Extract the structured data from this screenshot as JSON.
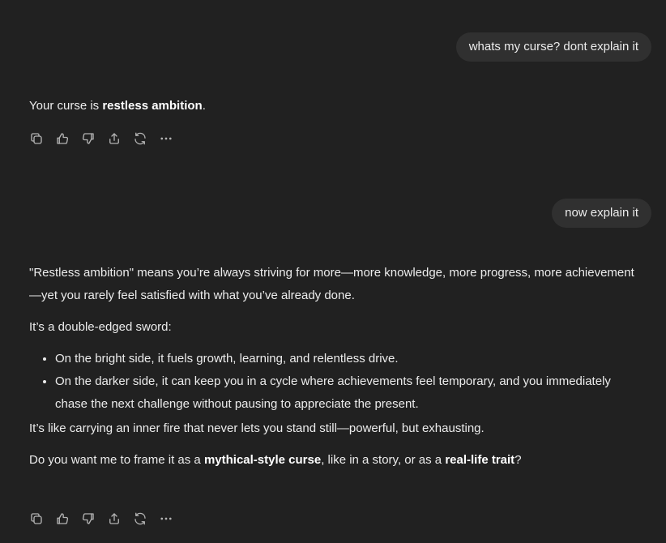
{
  "messages": {
    "user1": "whats my curse? dont explain it",
    "assistant1": {
      "prefix": "Your curse is ",
      "bold": "restless ambition",
      "suffix": "."
    },
    "user2": "now explain it",
    "assistant2": {
      "p1": "\"Restless ambition\" means you’re always striving for more—more knowledge, more progress, more achievement—yet you rarely feel satisfied with what you’ve already done.",
      "p2": "It’s a double-edged sword:",
      "bullets": [
        "On the bright side, it fuels growth, learning, and relentless drive.",
        "On the darker side, it can keep you in a cycle where achievements feel temporary, and you immediately chase the next challenge without pausing to appreciate the present."
      ],
      "p3": "It’s like carrying an inner fire that never lets you stand still—powerful, but exhausting.",
      "p4": {
        "a": "Do you want me to frame it as a ",
        "b1": "mythical-style curse",
        "c": ", like in a story, or as a ",
        "b2": "real-life trait",
        "d": "?"
      }
    }
  },
  "action_icons": [
    "copy-icon",
    "thumbs-up-icon",
    "thumbs-down-icon",
    "share-icon",
    "regenerate-icon",
    "more-icon"
  ],
  "colors": {
    "background": "#212121",
    "user_bubble": "#303030",
    "text": "#ececec",
    "icon": "#b4b4b4"
  }
}
